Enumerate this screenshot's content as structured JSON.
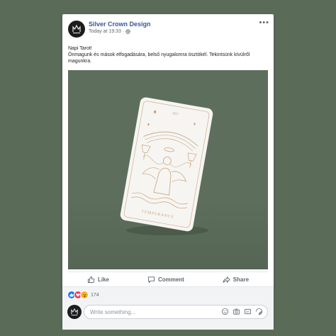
{
  "post": {
    "page_name": "Silver Crown Design",
    "timestamp": "Today at 19:33",
    "privacy_icon": "globe-icon",
    "text_line1": "Napi Tarot!",
    "text_line2": "Önmagunk és mások elfogadására, belső nyugalomra ösztökél. Tekintsünk kívülről magunkra."
  },
  "image": {
    "card_title": "TEMPERANCE",
    "card_number": "XIV"
  },
  "actions": {
    "like": "Like",
    "comment": "Comment",
    "share": "Share"
  },
  "reactions": {
    "count": "174",
    "types": [
      "like",
      "love",
      "wow"
    ]
  },
  "comment": {
    "placeholder": "Write something..."
  },
  "colors": {
    "background": "#5a6b58",
    "link": "#385898",
    "gold": "#c9a27a"
  }
}
